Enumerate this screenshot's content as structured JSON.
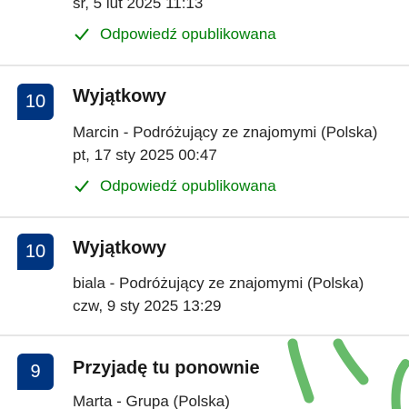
{
  "reviews": [
    {
      "date": "śr, 5 lut 2025 11:13",
      "response_status": "Odpowiedź opublikowana"
    },
    {
      "score": "10",
      "title": "Wyjątkowy",
      "author": "Marcin - Podróżujący ze znajomymi (Polska)",
      "date": "pt, 17 sty 2025 00:47",
      "response_status": "Odpowiedź opublikowana"
    },
    {
      "score": "10",
      "title": "Wyjątkowy",
      "author": "biala - Podróżujący ze znajomymi (Polska)",
      "date": "czw, 9 sty 2025 13:29"
    },
    {
      "score": "9",
      "title": "Przyjadę tu ponownie",
      "author": "Marta - Grupa (Polska)"
    }
  ],
  "colors": {
    "score_badge": "#003580",
    "response_green": "#008009",
    "annotation_green": "#4caf50"
  },
  "icons": {
    "response": "check-icon"
  }
}
